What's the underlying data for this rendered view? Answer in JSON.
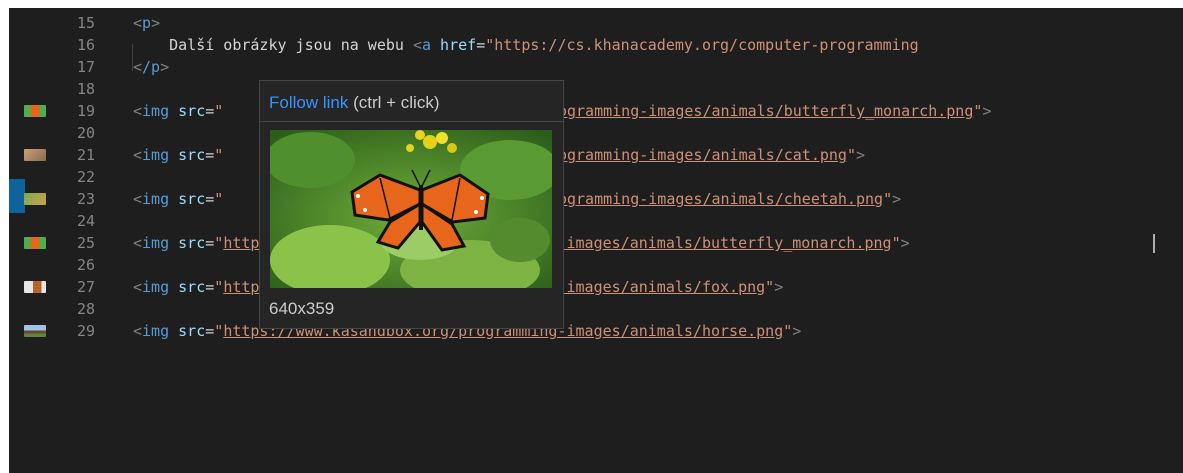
{
  "editor": {
    "lines": [
      {
        "num": "15",
        "kind": "p-open",
        "text": "<p>"
      },
      {
        "num": "16",
        "kind": "text-link",
        "prefix": "    Další obrázky jsou na webu ",
        "tag_open": "<a",
        "attr": " href",
        "eq": "=",
        "value": "\"https://cs.khanacademy.org/computer-programming"
      },
      {
        "num": "17",
        "kind": "p-close",
        "text": "</p>"
      },
      {
        "num": "18",
        "kind": "empty"
      },
      {
        "num": "19",
        "kind": "img",
        "visible_src": "/programming-images/animals/butterfly_monarch.png",
        "truncated": true
      },
      {
        "num": "20",
        "kind": "empty"
      },
      {
        "num": "21",
        "kind": "img",
        "visible_src": "/programming-images/animals/cat.png",
        "truncated": true
      },
      {
        "num": "22",
        "kind": "empty"
      },
      {
        "num": "23",
        "kind": "img",
        "visible_src": "/programming-images/animals/cheetah.png",
        "truncated": true
      },
      {
        "num": "24",
        "kind": "empty"
      },
      {
        "num": "25",
        "kind": "img",
        "visible_src": "https://www.kasandbox.org/programming-images/animals/butterfly_monarch.png",
        "truncated": false
      },
      {
        "num": "26",
        "kind": "empty"
      },
      {
        "num": "27",
        "kind": "img",
        "visible_src": "https://www.kasandbox.org/programming-images/animals/fox.png",
        "truncated": false
      },
      {
        "num": "28",
        "kind": "empty"
      },
      {
        "num": "29",
        "kind": "img",
        "visible_src": "https://www.kasandbox.org/programming-images/animals/horse.png",
        "truncated": false
      }
    ],
    "img_tag": "<img",
    "src_attr": " src",
    "eq": "=",
    "quote": "\"",
    "close": ">",
    "gutter_thumbnails": {
      "19": "butterfly-thumbnail",
      "21": "cat-thumbnail",
      "23": "cheetah-thumbnail",
      "25": "butterfly-thumbnail",
      "27": "fox-thumbnail",
      "29": "horse-thumbnail"
    }
  },
  "hover": {
    "link_label": "Follow link",
    "link_hint": " (ctrl + click)",
    "image_dims": "640x359",
    "preview_subject": "monarch butterfly on green leaves"
  },
  "colors": {
    "background": "#1e1e1e",
    "tag": "#569cd6",
    "attr": "#9cdcfe",
    "string": "#ce9178",
    "punctuation": "#808080",
    "line_number": "#858585",
    "link": "#3794ff",
    "active_bar": "#0e639c"
  }
}
